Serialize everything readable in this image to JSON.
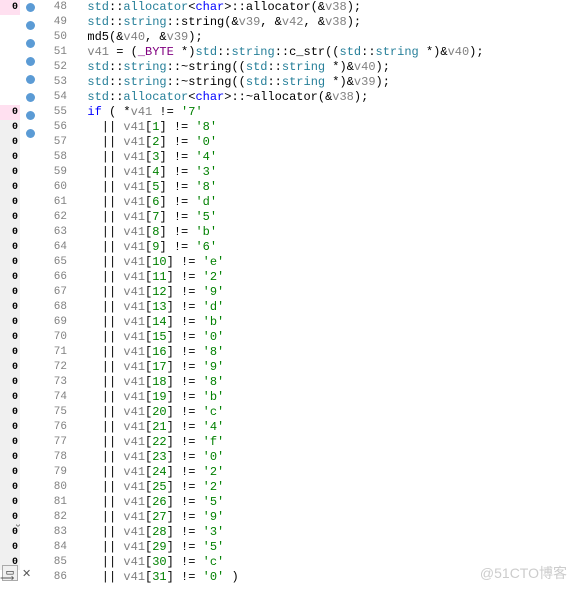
{
  "watermark": "@51CTO博客",
  "gutter_left": [
    "0",
    "",
    "",
    "",
    "",
    "",
    "",
    "0",
    "0",
    "0",
    "0",
    "0",
    "0",
    "0",
    "0",
    "0",
    "0",
    "0",
    "0",
    "0",
    "0",
    "0",
    "0",
    "0",
    "0",
    "0",
    "0",
    "0",
    "0",
    "0",
    "0",
    "0",
    "0",
    "0",
    "0",
    "0",
    "0",
    "0",
    ">"
  ],
  "tab_icon": "▭",
  "lines": [
    {
      "no": 48,
      "bp": true,
      "seg": [
        [
          "  ",
          "punc"
        ],
        [
          "std",
          "type"
        ],
        [
          "::",
          "punc"
        ],
        [
          "allocator",
          "type"
        ],
        [
          "<",
          "punc"
        ],
        [
          "char",
          "kw"
        ],
        [
          ">::",
          "punc"
        ],
        [
          "allocator",
          "fn"
        ],
        [
          "(&",
          ""
        ],
        [
          "v38",
          "var"
        ],
        [
          ");",
          ""
        ]
      ]
    },
    {
      "no": 49,
      "bp": true,
      "seg": [
        [
          "  ",
          ""
        ],
        [
          "std",
          "type"
        ],
        [
          "::",
          "punc"
        ],
        [
          "string",
          "type"
        ],
        [
          "::",
          "punc"
        ],
        [
          "string",
          "fn"
        ],
        [
          "(&",
          ""
        ],
        [
          "v39",
          "var"
        ],
        [
          ", &",
          ""
        ],
        [
          "v42",
          "var"
        ],
        [
          ", &",
          ""
        ],
        [
          "v38",
          "var"
        ],
        [
          ");",
          ""
        ]
      ]
    },
    {
      "no": 50,
      "bp": true,
      "seg": [
        [
          "  ",
          ""
        ],
        [
          "md5",
          "fn"
        ],
        [
          "(&",
          ""
        ],
        [
          "v40",
          "var"
        ],
        [
          ", &",
          ""
        ],
        [
          "v39",
          "var"
        ],
        [
          ");",
          ""
        ]
      ]
    },
    {
      "no": 51,
      "bp": true,
      "seg": [
        [
          "  ",
          ""
        ],
        [
          "v41",
          "var"
        ],
        [
          " = (",
          ""
        ],
        [
          "_BYTE",
          "cast"
        ],
        [
          " *)",
          ""
        ],
        [
          "std",
          "type"
        ],
        [
          "::",
          "punc"
        ],
        [
          "string",
          "type"
        ],
        [
          "::",
          "punc"
        ],
        [
          "c_str",
          "fn"
        ],
        [
          "((",
          ""
        ],
        [
          "std",
          "type"
        ],
        [
          "::",
          "punc"
        ],
        [
          "string",
          "type"
        ],
        [
          " *)&",
          ""
        ],
        [
          "v40",
          "var"
        ],
        [
          ");",
          ""
        ]
      ]
    },
    {
      "no": 52,
      "bp": true,
      "seg": [
        [
          "  ",
          ""
        ],
        [
          "std",
          "type"
        ],
        [
          "::",
          "punc"
        ],
        [
          "string",
          "type"
        ],
        [
          "::~",
          "punc"
        ],
        [
          "string",
          "fn"
        ],
        [
          "((",
          ""
        ],
        [
          "std",
          "type"
        ],
        [
          "::",
          "punc"
        ],
        [
          "string",
          "type"
        ],
        [
          " *)&",
          ""
        ],
        [
          "v40",
          "var"
        ],
        [
          ");",
          ""
        ]
      ]
    },
    {
      "no": 53,
      "bp": true,
      "seg": [
        [
          "  ",
          ""
        ],
        [
          "std",
          "type"
        ],
        [
          "::",
          "punc"
        ],
        [
          "string",
          "type"
        ],
        [
          "::~",
          "punc"
        ],
        [
          "string",
          "fn"
        ],
        [
          "((",
          ""
        ],
        [
          "std",
          "type"
        ],
        [
          "::",
          "punc"
        ],
        [
          "string",
          "type"
        ],
        [
          " *)&",
          ""
        ],
        [
          "v39",
          "var"
        ],
        [
          ");",
          ""
        ]
      ]
    },
    {
      "no": 54,
      "bp": true,
      "seg": [
        [
          "  ",
          ""
        ],
        [
          "std",
          "type"
        ],
        [
          "::",
          "punc"
        ],
        [
          "allocator",
          "type"
        ],
        [
          "<",
          "punc"
        ],
        [
          "char",
          "kw"
        ],
        [
          ">::~",
          "punc"
        ],
        [
          "allocator",
          "fn"
        ],
        [
          "(&",
          ""
        ],
        [
          "v38",
          "var"
        ],
        [
          ");",
          ""
        ]
      ]
    },
    {
      "no": 55,
      "bp": true,
      "seg": [
        [
          "  ",
          ""
        ],
        [
          "if",
          "kw"
        ],
        [
          " ( *",
          ""
        ],
        [
          "v41",
          "var"
        ],
        [
          " != ",
          ""
        ],
        [
          "'7'",
          "char"
        ]
      ]
    },
    {
      "no": 56,
      "bp": false,
      "seg": [
        [
          "    || ",
          ""
        ],
        [
          "v41",
          "var"
        ],
        [
          "[",
          ""
        ],
        [
          "1",
          "num"
        ],
        [
          "] != ",
          ""
        ],
        [
          "'8'",
          "char"
        ]
      ]
    },
    {
      "no": 57,
      "bp": false,
      "seg": [
        [
          "    || ",
          ""
        ],
        [
          "v41",
          "var"
        ],
        [
          "[",
          ""
        ],
        [
          "2",
          "num"
        ],
        [
          "] != ",
          ""
        ],
        [
          "'0'",
          "char"
        ]
      ]
    },
    {
      "no": 58,
      "bp": false,
      "seg": [
        [
          "    || ",
          ""
        ],
        [
          "v41",
          "var"
        ],
        [
          "[",
          ""
        ],
        [
          "3",
          "num"
        ],
        [
          "] != ",
          ""
        ],
        [
          "'4'",
          "char"
        ]
      ]
    },
    {
      "no": 59,
      "bp": false,
      "seg": [
        [
          "    || ",
          ""
        ],
        [
          "v41",
          "var"
        ],
        [
          "[",
          ""
        ],
        [
          "4",
          "num"
        ],
        [
          "] != ",
          ""
        ],
        [
          "'3'",
          "char"
        ]
      ]
    },
    {
      "no": 60,
      "bp": false,
      "seg": [
        [
          "    || ",
          ""
        ],
        [
          "v41",
          "var"
        ],
        [
          "[",
          ""
        ],
        [
          "5",
          "num"
        ],
        [
          "] != ",
          ""
        ],
        [
          "'8'",
          "char"
        ]
      ]
    },
    {
      "no": 61,
      "bp": false,
      "seg": [
        [
          "    || ",
          ""
        ],
        [
          "v41",
          "var"
        ],
        [
          "[",
          ""
        ],
        [
          "6",
          "num"
        ],
        [
          "] != ",
          ""
        ],
        [
          "'d'",
          "char"
        ]
      ]
    },
    {
      "no": 62,
      "bp": false,
      "seg": [
        [
          "    || ",
          ""
        ],
        [
          "v41",
          "var"
        ],
        [
          "[",
          ""
        ],
        [
          "7",
          "num"
        ],
        [
          "] != ",
          ""
        ],
        [
          "'5'",
          "char"
        ]
      ]
    },
    {
      "no": 63,
      "bp": false,
      "seg": [
        [
          "    || ",
          ""
        ],
        [
          "v41",
          "var"
        ],
        [
          "[",
          ""
        ],
        [
          "8",
          "num"
        ],
        [
          "] != ",
          ""
        ],
        [
          "'b'",
          "char"
        ]
      ]
    },
    {
      "no": 64,
      "bp": false,
      "seg": [
        [
          "    || ",
          ""
        ],
        [
          "v41",
          "var"
        ],
        [
          "[",
          ""
        ],
        [
          "9",
          "num"
        ],
        [
          "] != ",
          ""
        ],
        [
          "'6'",
          "char"
        ]
      ]
    },
    {
      "no": 65,
      "bp": false,
      "seg": [
        [
          "    || ",
          ""
        ],
        [
          "v41",
          "var"
        ],
        [
          "[",
          ""
        ],
        [
          "10",
          "num"
        ],
        [
          "] != ",
          ""
        ],
        [
          "'e'",
          "char"
        ]
      ]
    },
    {
      "no": 66,
      "bp": false,
      "seg": [
        [
          "    || ",
          ""
        ],
        [
          "v41",
          "var"
        ],
        [
          "[",
          ""
        ],
        [
          "11",
          "num"
        ],
        [
          "] != ",
          ""
        ],
        [
          "'2'",
          "char"
        ]
      ]
    },
    {
      "no": 67,
      "bp": false,
      "seg": [
        [
          "    || ",
          ""
        ],
        [
          "v41",
          "var"
        ],
        [
          "[",
          ""
        ],
        [
          "12",
          "num"
        ],
        [
          "] != ",
          ""
        ],
        [
          "'9'",
          "char"
        ]
      ]
    },
    {
      "no": 68,
      "bp": false,
      "seg": [
        [
          "    || ",
          ""
        ],
        [
          "v41",
          "var"
        ],
        [
          "[",
          ""
        ],
        [
          "13",
          "num"
        ],
        [
          "] != ",
          ""
        ],
        [
          "'d'",
          "char"
        ]
      ]
    },
    {
      "no": 69,
      "bp": false,
      "seg": [
        [
          "    || ",
          ""
        ],
        [
          "v41",
          "var"
        ],
        [
          "[",
          ""
        ],
        [
          "14",
          "num"
        ],
        [
          "] != ",
          ""
        ],
        [
          "'b'",
          "char"
        ]
      ]
    },
    {
      "no": 70,
      "bp": false,
      "seg": [
        [
          "    || ",
          ""
        ],
        [
          "v41",
          "var"
        ],
        [
          "[",
          ""
        ],
        [
          "15",
          "num"
        ],
        [
          "] != ",
          ""
        ],
        [
          "'0'",
          "char"
        ]
      ]
    },
    {
      "no": 71,
      "bp": false,
      "seg": [
        [
          "    || ",
          ""
        ],
        [
          "v41",
          "var"
        ],
        [
          "[",
          ""
        ],
        [
          "16",
          "num"
        ],
        [
          "] != ",
          ""
        ],
        [
          "'8'",
          "char"
        ]
      ]
    },
    {
      "no": 72,
      "bp": false,
      "seg": [
        [
          "    || ",
          ""
        ],
        [
          "v41",
          "var"
        ],
        [
          "[",
          ""
        ],
        [
          "17",
          "num"
        ],
        [
          "] != ",
          ""
        ],
        [
          "'9'",
          "char"
        ]
      ]
    },
    {
      "no": 73,
      "bp": false,
      "seg": [
        [
          "    || ",
          ""
        ],
        [
          "v41",
          "var"
        ],
        [
          "[",
          ""
        ],
        [
          "18",
          "num"
        ],
        [
          "] != ",
          ""
        ],
        [
          "'8'",
          "char"
        ]
      ]
    },
    {
      "no": 74,
      "bp": false,
      "seg": [
        [
          "    || ",
          ""
        ],
        [
          "v41",
          "var"
        ],
        [
          "[",
          ""
        ],
        [
          "19",
          "num"
        ],
        [
          "] != ",
          ""
        ],
        [
          "'b'",
          "char"
        ]
      ]
    },
    {
      "no": 75,
      "bp": false,
      "seg": [
        [
          "    || ",
          ""
        ],
        [
          "v41",
          "var"
        ],
        [
          "[",
          ""
        ],
        [
          "20",
          "num"
        ],
        [
          "] != ",
          ""
        ],
        [
          "'c'",
          "char"
        ]
      ]
    },
    {
      "no": 76,
      "bp": false,
      "seg": [
        [
          "    || ",
          ""
        ],
        [
          "v41",
          "var"
        ],
        [
          "[",
          ""
        ],
        [
          "21",
          "num"
        ],
        [
          "] != ",
          ""
        ],
        [
          "'4'",
          "char"
        ]
      ]
    },
    {
      "no": 77,
      "bp": false,
      "seg": [
        [
          "    || ",
          ""
        ],
        [
          "v41",
          "var"
        ],
        [
          "[",
          ""
        ],
        [
          "22",
          "num"
        ],
        [
          "] != ",
          ""
        ],
        [
          "'f'",
          "char"
        ]
      ]
    },
    {
      "no": 78,
      "bp": false,
      "seg": [
        [
          "    || ",
          ""
        ],
        [
          "v41",
          "var"
        ],
        [
          "[",
          ""
        ],
        [
          "23",
          "num"
        ],
        [
          "] != ",
          ""
        ],
        [
          "'0'",
          "char"
        ]
      ]
    },
    {
      "no": 79,
      "bp": false,
      "seg": [
        [
          "    || ",
          ""
        ],
        [
          "v41",
          "var"
        ],
        [
          "[",
          ""
        ],
        [
          "24",
          "num"
        ],
        [
          "] != ",
          ""
        ],
        [
          "'2'",
          "char"
        ]
      ]
    },
    {
      "no": 80,
      "bp": false,
      "seg": [
        [
          "    || ",
          ""
        ],
        [
          "v41",
          "var"
        ],
        [
          "[",
          ""
        ],
        [
          "25",
          "num"
        ],
        [
          "] != ",
          ""
        ],
        [
          "'2'",
          "char"
        ]
      ]
    },
    {
      "no": 81,
      "bp": false,
      "seg": [
        [
          "    || ",
          ""
        ],
        [
          "v41",
          "var"
        ],
        [
          "[",
          ""
        ],
        [
          "26",
          "num"
        ],
        [
          "] != ",
          ""
        ],
        [
          "'5'",
          "char"
        ]
      ]
    },
    {
      "no": 82,
      "bp": false,
      "seg": [
        [
          "    || ",
          ""
        ],
        [
          "v41",
          "var"
        ],
        [
          "[",
          ""
        ],
        [
          "27",
          "num"
        ],
        [
          "] != ",
          ""
        ],
        [
          "'9'",
          "char"
        ]
      ]
    },
    {
      "no": 83,
      "bp": false,
      "seg": [
        [
          "    || ",
          ""
        ],
        [
          "v41",
          "var"
        ],
        [
          "[",
          ""
        ],
        [
          "28",
          "num"
        ],
        [
          "] != ",
          ""
        ],
        [
          "'3'",
          "char"
        ]
      ]
    },
    {
      "no": 84,
      "bp": false,
      "seg": [
        [
          "    || ",
          ""
        ],
        [
          "v41",
          "var"
        ],
        [
          "[",
          ""
        ],
        [
          "29",
          "num"
        ],
        [
          "] != ",
          ""
        ],
        [
          "'5'",
          "char"
        ]
      ]
    },
    {
      "no": 85,
      "bp": false,
      "seg": [
        [
          "    || ",
          ""
        ],
        [
          "v41",
          "var"
        ],
        [
          "[",
          ""
        ],
        [
          "30",
          "num"
        ],
        [
          "] != ",
          ""
        ],
        [
          "'c'",
          "char"
        ]
      ]
    },
    {
      "no": 86,
      "bp": false,
      "seg": [
        [
          "    || ",
          ""
        ],
        [
          "v41",
          "var"
        ],
        [
          "[",
          ""
        ],
        [
          "31",
          "num"
        ],
        [
          "] != ",
          ""
        ],
        [
          "'0'",
          "char"
        ],
        [
          " )",
          ""
        ]
      ]
    }
  ]
}
